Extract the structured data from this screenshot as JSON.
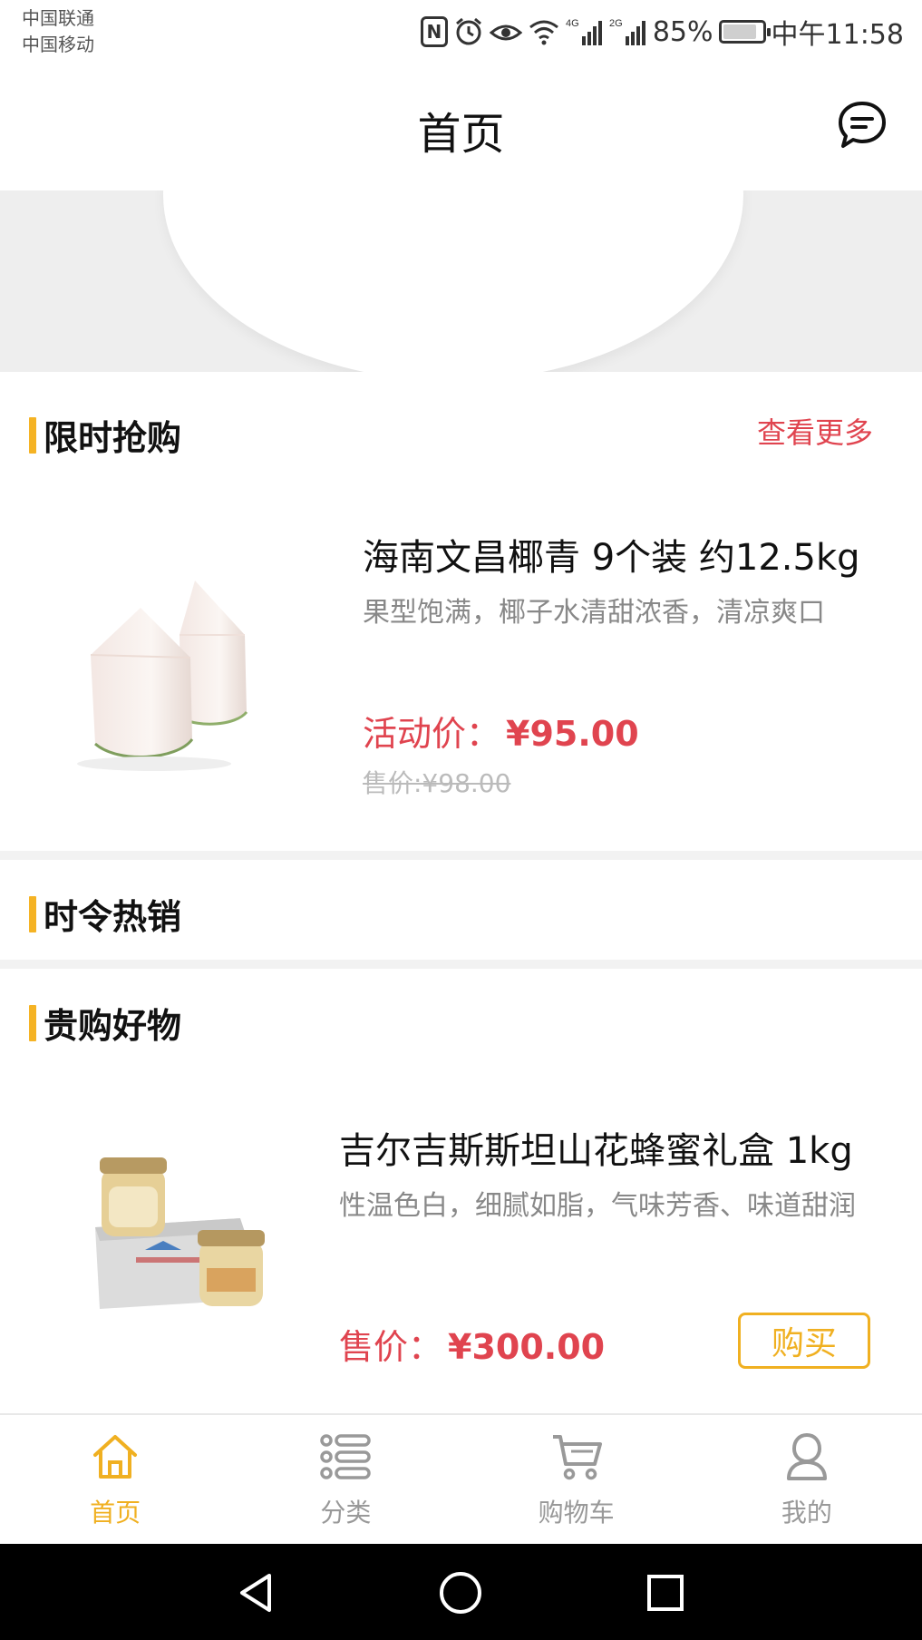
{
  "status_bar": {
    "carrier_1": "中国联通",
    "carrier_2": "中国移动",
    "nfc_label": "N",
    "net_1": "4G",
    "net_2": "2G",
    "battery_text": "85%",
    "battery_level": 0.85,
    "time": "中午11:58"
  },
  "header": {
    "title": "首页",
    "message_icon": "chat-bubble-icon"
  },
  "banner": {
    "indicator_count": 1
  },
  "flash_sale": {
    "title": "限时抢购",
    "more_label": "查看更多",
    "product": {
      "name": "海南文昌椰青 9个装 约12.5kg",
      "desc": "果型饱满，椰子水清甜浓香，清凉爽口",
      "price_label": "活动价：",
      "price": "¥95.00",
      "original_price": "售价:¥98.00"
    }
  },
  "seasonal": {
    "title": "时令热销"
  },
  "premium": {
    "title": "贵购好物",
    "product": {
      "name": "吉尔吉斯斯坦山花蜂蜜礼盒 1kg",
      "desc": "性温色白，细腻如脂，气味芳香、味道甜润",
      "price_label": "售价：",
      "price": "¥300.00",
      "buy_label": "购买"
    }
  },
  "tabbar": {
    "items": [
      {
        "label": "首页",
        "icon": "home-icon",
        "active": true
      },
      {
        "label": "分类",
        "icon": "category-list-icon",
        "active": false
      },
      {
        "label": "购物车",
        "icon": "cart-icon",
        "active": false
      },
      {
        "label": "我的",
        "icon": "user-icon",
        "active": false
      }
    ]
  },
  "colors": {
    "accent": "#f0b021",
    "price_red": "#e0444f",
    "section_bar": "#f5b324"
  }
}
